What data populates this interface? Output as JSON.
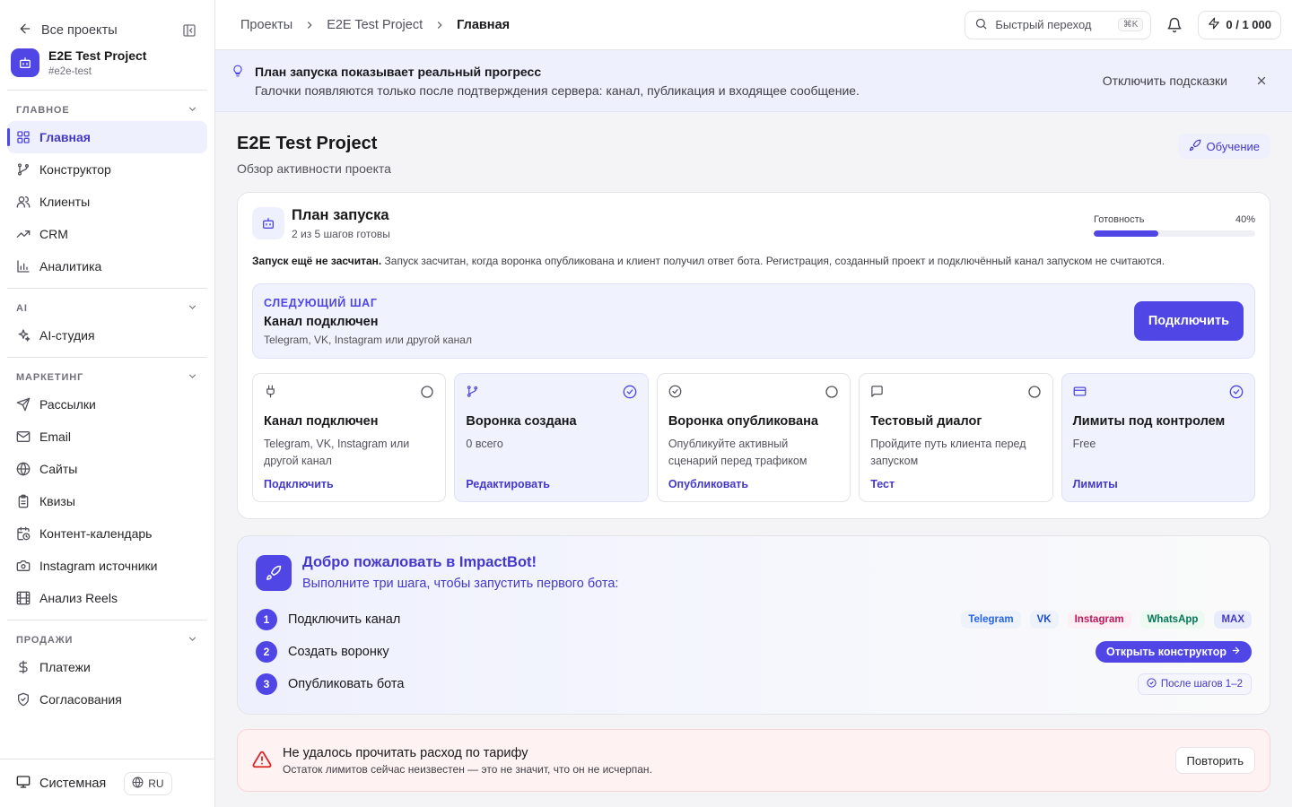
{
  "sidebar": {
    "back_label": "Все проекты",
    "project": {
      "name": "E2E Test Project",
      "slug": "#e2e-test"
    },
    "sections": [
      {
        "title": "ГЛАВНОЕ",
        "items": [
          {
            "label": "Главная",
            "icon": "layout-grid-icon",
            "active": true
          },
          {
            "label": "Конструктор",
            "icon": "git-branch-icon"
          },
          {
            "label": "Клиенты",
            "icon": "users-icon"
          },
          {
            "label": "CRM",
            "icon": "trending-up-icon"
          },
          {
            "label": "Аналитика",
            "icon": "bar-chart-icon"
          }
        ]
      },
      {
        "title": "AI",
        "items": [
          {
            "label": "AI-студия",
            "icon": "sparkles-icon"
          }
        ]
      },
      {
        "title": "МАРКЕТИНГ",
        "items": [
          {
            "label": "Рассылки",
            "icon": "send-icon"
          },
          {
            "label": "Email",
            "icon": "mail-icon"
          },
          {
            "label": "Сайты",
            "icon": "globe-icon"
          },
          {
            "label": "Квизы",
            "icon": "clipboard-icon"
          },
          {
            "label": "Контент-календарь",
            "icon": "calendar-clock-icon"
          },
          {
            "label": "Instagram источники",
            "icon": "camera-icon"
          },
          {
            "label": "Анализ Reels",
            "icon": "film-icon"
          }
        ]
      },
      {
        "title": "ПРОДАЖИ",
        "items": [
          {
            "label": "Платежи",
            "icon": "dollar-icon"
          },
          {
            "label": "Согласования",
            "icon": "shield-check-icon"
          }
        ]
      }
    ],
    "theme_label": "Системная",
    "lang_label": "RU"
  },
  "topbar": {
    "crumbs": [
      "Проекты",
      "E2E Test Project",
      "Главная"
    ],
    "quick_placeholder": "Быстрый переход",
    "quick_kbd": "⌘K",
    "credits": "0 / 1 000"
  },
  "hint": {
    "title": "План запуска показывает реальный прогресс",
    "subtitle": "Галочки появляются только после подтверждения сервера: канал, публикация и входящее сообщение.",
    "disable_label": "Отключить подсказки"
  },
  "page": {
    "title": "E2E Test Project",
    "subtitle": "Обзор активности проекта",
    "learn_label": "Обучение"
  },
  "launch": {
    "title": "План запуска",
    "subtitle": "2 из 5 шагов готовы",
    "readiness_label": "Готовность",
    "readiness_value": "40%",
    "readiness_fraction": 0.4,
    "notice_bold": "Запуск ещё не засчитан.",
    "notice_rest": " Запуск засчитан, когда воронка опубликована и клиент получил ответ бота. Регистрация, созданный проект и подключённый канал запуском не считаются.",
    "next": {
      "eyebrow": "СЛЕДУЮЩИЙ ШАГ",
      "title": "Канал подключен",
      "subtitle": "Telegram, VK, Instagram или другой канал",
      "button": "Подключить"
    },
    "steps": [
      {
        "title": "Канал подключен",
        "desc": "Telegram, VK, Instagram или другой канал",
        "link": "Подключить",
        "icon": "plug-icon",
        "done": false
      },
      {
        "title": "Воронка создана",
        "desc": "0 всего",
        "link": "Редактировать",
        "icon": "git-branch-icon",
        "done": true
      },
      {
        "title": "Воронка опубликована",
        "desc": "Опубликуйте активный сценарий перед трафиком",
        "link": "Опубликовать",
        "icon": "check-circle-icon",
        "done": false
      },
      {
        "title": "Тестовый диалог",
        "desc": "Пройдите путь клиента перед запуском",
        "link": "Тест",
        "icon": "message-square-icon",
        "done": false
      },
      {
        "title": "Лимиты под контролем",
        "desc": "Free",
        "link": "Лимиты",
        "icon": "credit-card-icon",
        "done": true
      }
    ]
  },
  "welcome": {
    "title": "Добро пожаловать в ImpactBot!",
    "subtitle": "Выполните три шага, чтобы запустить первого бота:",
    "steps": [
      {
        "num": "1",
        "label": "Подключить канал"
      },
      {
        "num": "2",
        "label": "Создать воронку"
      },
      {
        "num": "3",
        "label": "Опубликовать бота"
      }
    ],
    "channels": [
      "Telegram",
      "VK",
      "Instagram",
      "WhatsApp",
      "MAX"
    ],
    "open_label": "Открыть конструктор",
    "after_label": "После шагов 1–2"
  },
  "error": {
    "title": "Не удалось прочитать расход по тарифу",
    "subtitle": "Остаток лимитов сейчас неизвестен — это не значит, что он не исчерпан.",
    "retry": "Повторить"
  }
}
